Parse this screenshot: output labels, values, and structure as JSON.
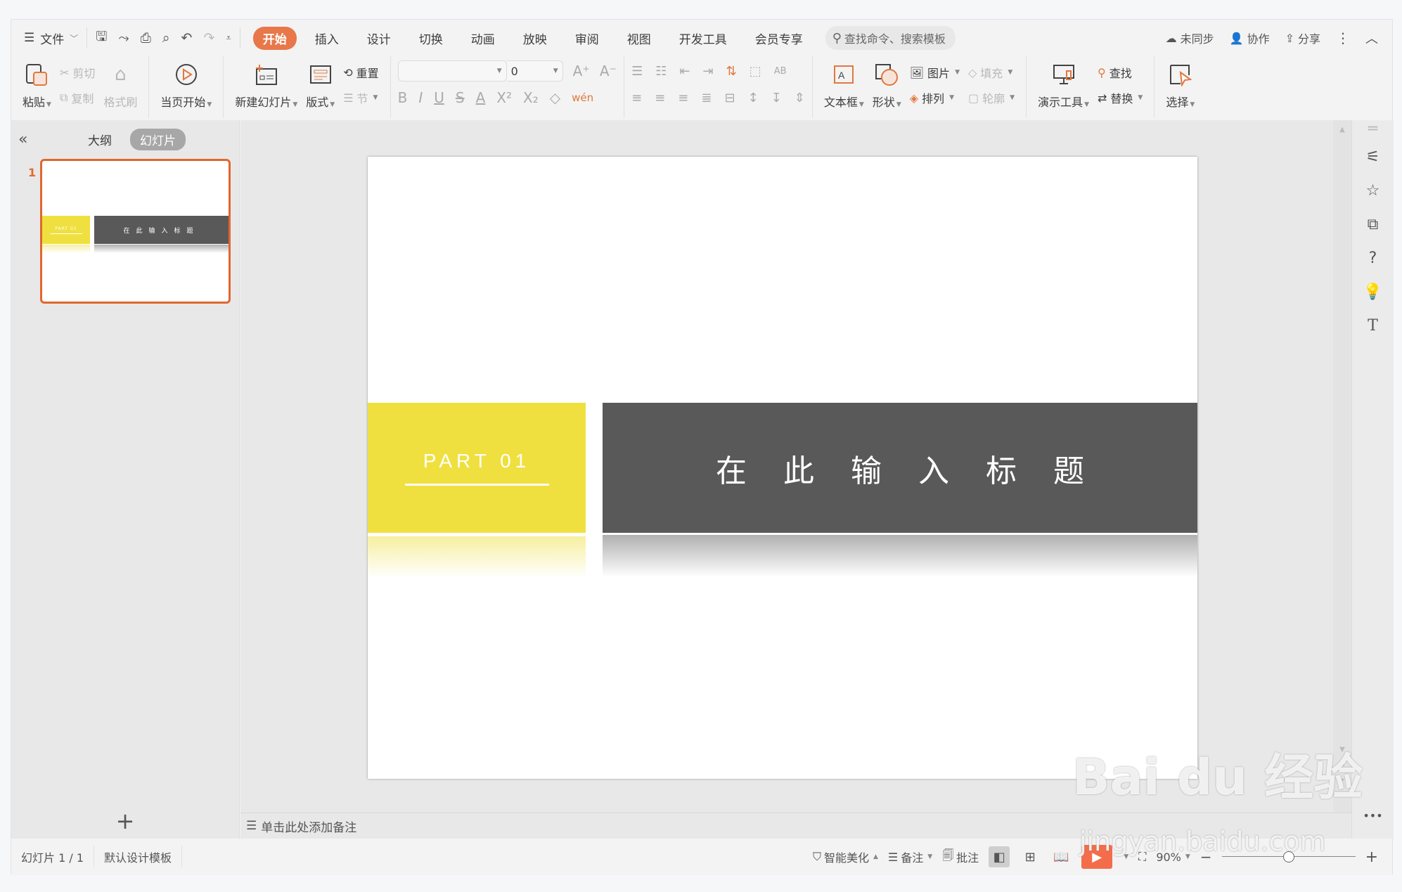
{
  "titlebar": {
    "file_menu": "文件",
    "tabs": [
      {
        "label": "开始",
        "active": true
      },
      {
        "label": "插入"
      },
      {
        "label": "设计"
      },
      {
        "label": "切换"
      },
      {
        "label": "动画"
      },
      {
        "label": "放映"
      },
      {
        "label": "审阅"
      },
      {
        "label": "视图"
      },
      {
        "label": "开发工具"
      },
      {
        "label": "会员专享"
      }
    ],
    "search_placeholder": "查找命令、搜索模板",
    "right": {
      "sync": "未同步",
      "collab": "协作",
      "share": "分享"
    }
  },
  "ribbon": {
    "paste": "粘贴",
    "cut": "剪切",
    "copy": "复制",
    "format_painter": "格式刷",
    "play_from_current": "当页开始",
    "new_slide": "新建幻灯片",
    "layout": "版式",
    "reset": "重置",
    "section": "节",
    "font_name": "",
    "font_size": "0",
    "text_box": "文本框",
    "shape": "形状",
    "picture": "图片",
    "fill": "填充",
    "arrange": "排列",
    "outline": "轮廓",
    "presentation_tools": "演示工具",
    "find": "查找",
    "replace": "替换",
    "select": "选择"
  },
  "left_panel": {
    "tabs": [
      {
        "label": "大纲"
      },
      {
        "label": "幻灯片",
        "active": true
      }
    ],
    "slides": [
      {
        "number": "1",
        "part": "PART 01",
        "title": "在此输入标题"
      }
    ]
  },
  "slide": {
    "part_label": "PART 01",
    "title": "在此输入标题",
    "colors": {
      "accent": "#EFE03F",
      "dark": "#595959"
    }
  },
  "notes_placeholder": "单击此处添加备注",
  "status": {
    "slide_counter": "幻灯片 1 / 1",
    "template": "默认设计模板",
    "smart_beautify": "智能美化",
    "notes": "备注",
    "comments": "批注",
    "zoom": "90%",
    "zoom_fraction": 0.5
  },
  "watermark": {
    "logo": "Bai du 经验",
    "url": "jingyan.baidu.com"
  }
}
